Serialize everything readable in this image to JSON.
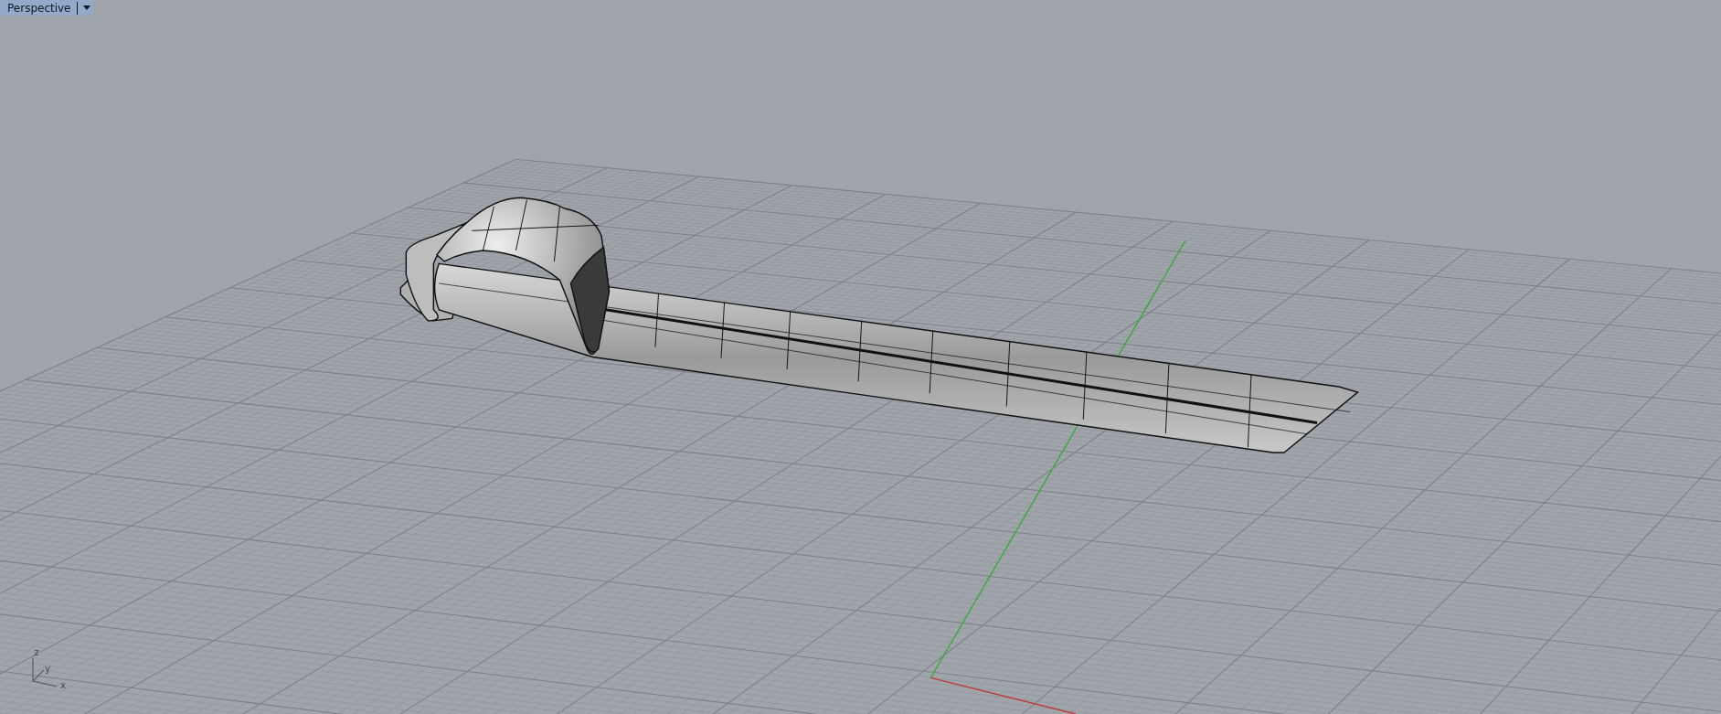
{
  "viewport_tab": {
    "label": "Perspective",
    "active": true
  },
  "axes_icon": {
    "labels": [
      "z",
      "y",
      "x"
    ]
  }
}
